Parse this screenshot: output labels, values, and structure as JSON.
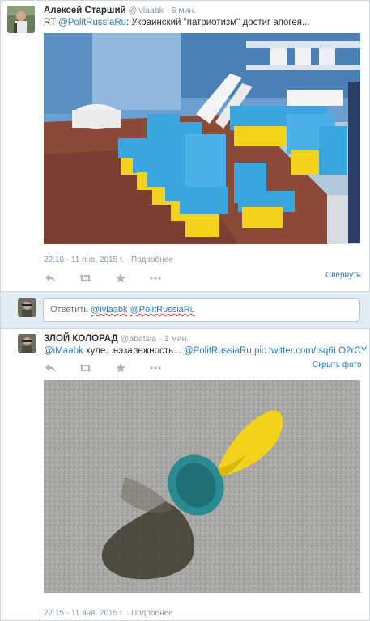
{
  "tweet1": {
    "author_name": "Алексей Старший",
    "author_handle": "@ivlaabk",
    "time": "· 6 мин.",
    "rt_prefix": "RT",
    "mention": "@PolitRussiaRu",
    "text": ": Украинский \"патриотизм\" достиг апогея...",
    "timestamp": "22:10 - 11 янв. 2015 г.",
    "details_link": "· Подробнее",
    "collapse_label": "Свернуть"
  },
  "reply": {
    "placeholder_prefix": "Ответить ",
    "mention1": "@ivlaabk",
    "mention2": "@PolitRussiaRu"
  },
  "tweet2": {
    "author_name": "ЗЛОЙ КОЛОРАД",
    "author_handle": "@abatsia",
    "time": "· 1 мин.",
    "mention1": "@iMaabk",
    "text": " хуле...нэзалежность...",
    "mention2": "@PolitRussiaRu",
    "pic_link": "pic.twitter.com/tsq6LO2rCY",
    "hide_photo_label": "Скрыть фото",
    "timestamp": "22:15 - 11 янв. 2015 г.",
    "details_link": "· Подробнее"
  },
  "icons": {
    "reply": "reply-icon",
    "retweet": "retweet-icon",
    "favorite": "star-icon",
    "more": "more-icon"
  },
  "colors": {
    "link": "#2b7bb9",
    "muted": "#8899a6",
    "reply_bg": "#e1ecf4",
    "toilet_blue": "#3aa6e0",
    "toilet_yellow": "#f2d21b"
  }
}
